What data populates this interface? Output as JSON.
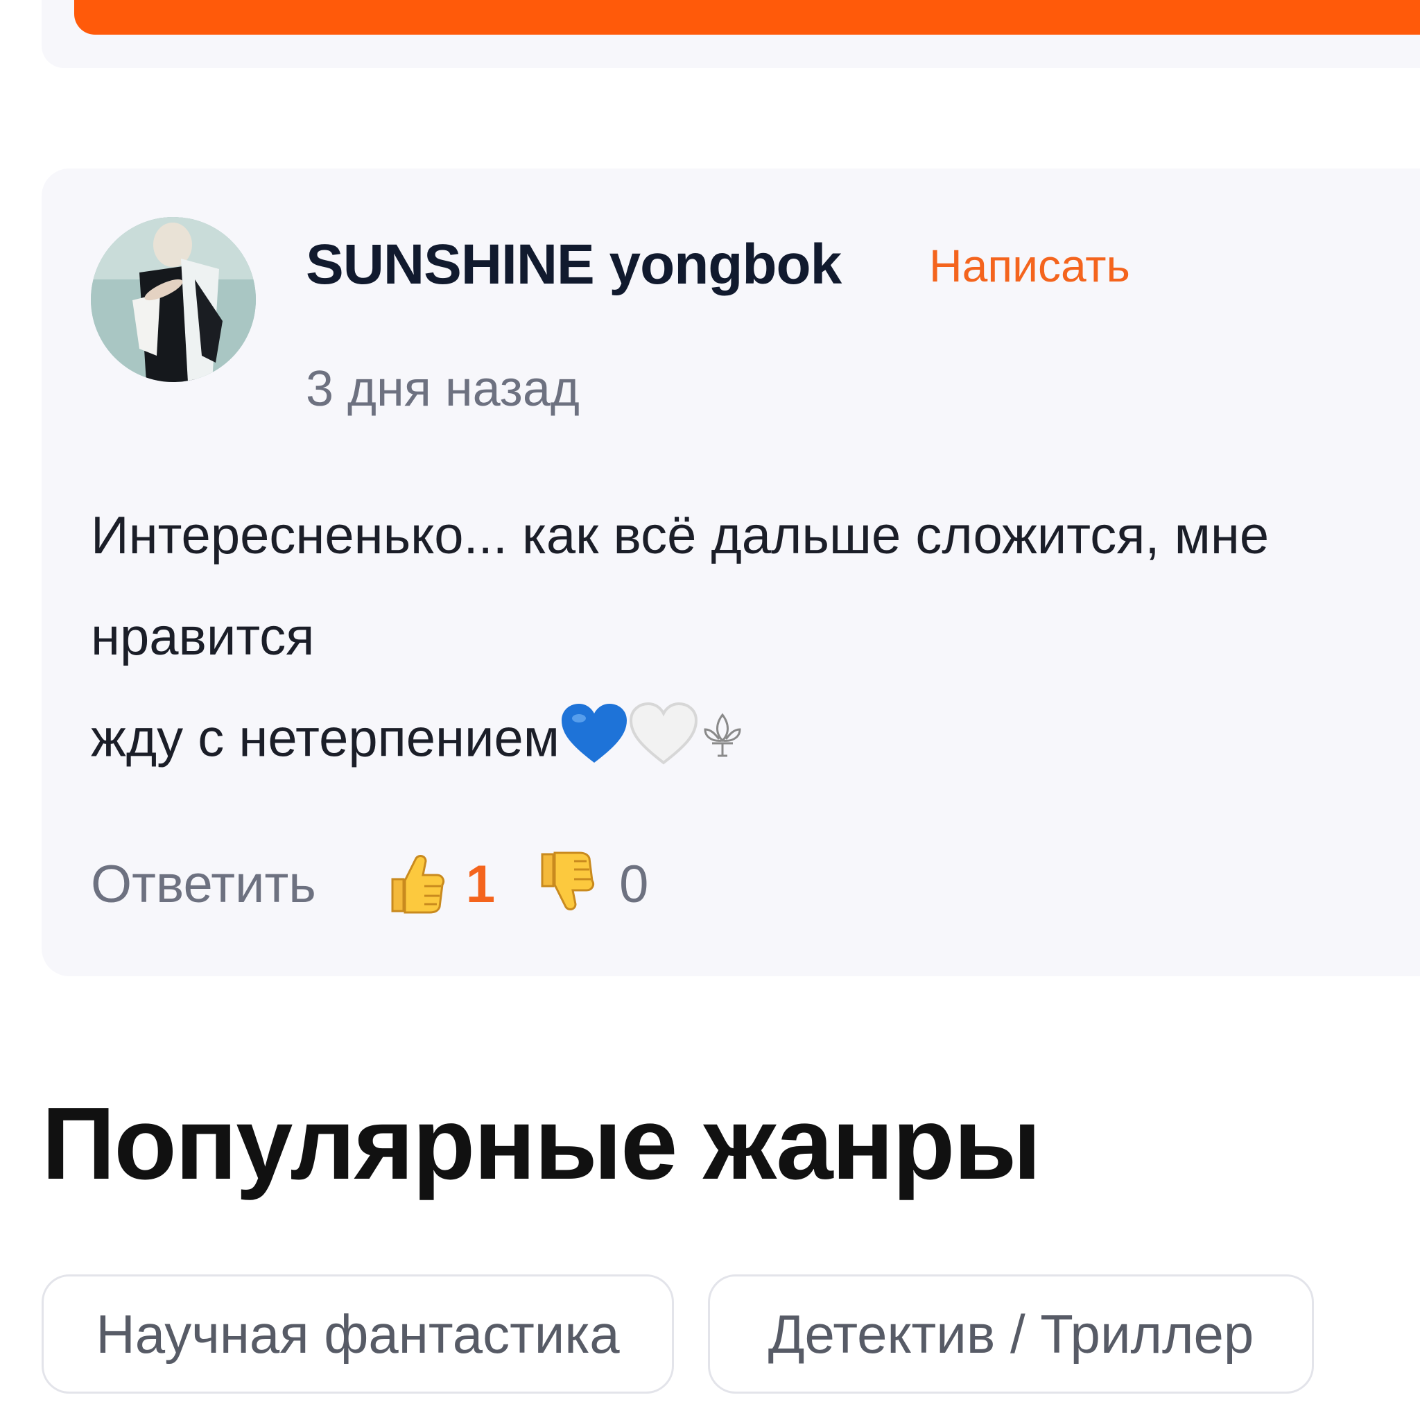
{
  "comment": {
    "username": "SUNSHINE yongbok",
    "write_label": "Написать",
    "timestamp": "3 дня назад",
    "text_line1": "Интересненько... как всё дальше сложится, мне нравится",
    "text_line2": "жду с нетерпением",
    "reply_label": "Ответить",
    "likes": "1",
    "dislikes": "0"
  },
  "genres": {
    "title": "Популярные жанры",
    "items": [
      "Научная фантастика",
      "Детектив / Триллер"
    ]
  },
  "colors": {
    "accent": "#ff5a0a",
    "link": "#f4641d",
    "card_bg": "#f7f7fb"
  },
  "icons": {
    "like": "thumbs-up-icon",
    "dislike": "thumbs-down-icon",
    "emoji_1": "blue-heart-icon",
    "emoji_2": "white-heart-icon",
    "emoji_3": "fleur-de-lis-icon"
  }
}
